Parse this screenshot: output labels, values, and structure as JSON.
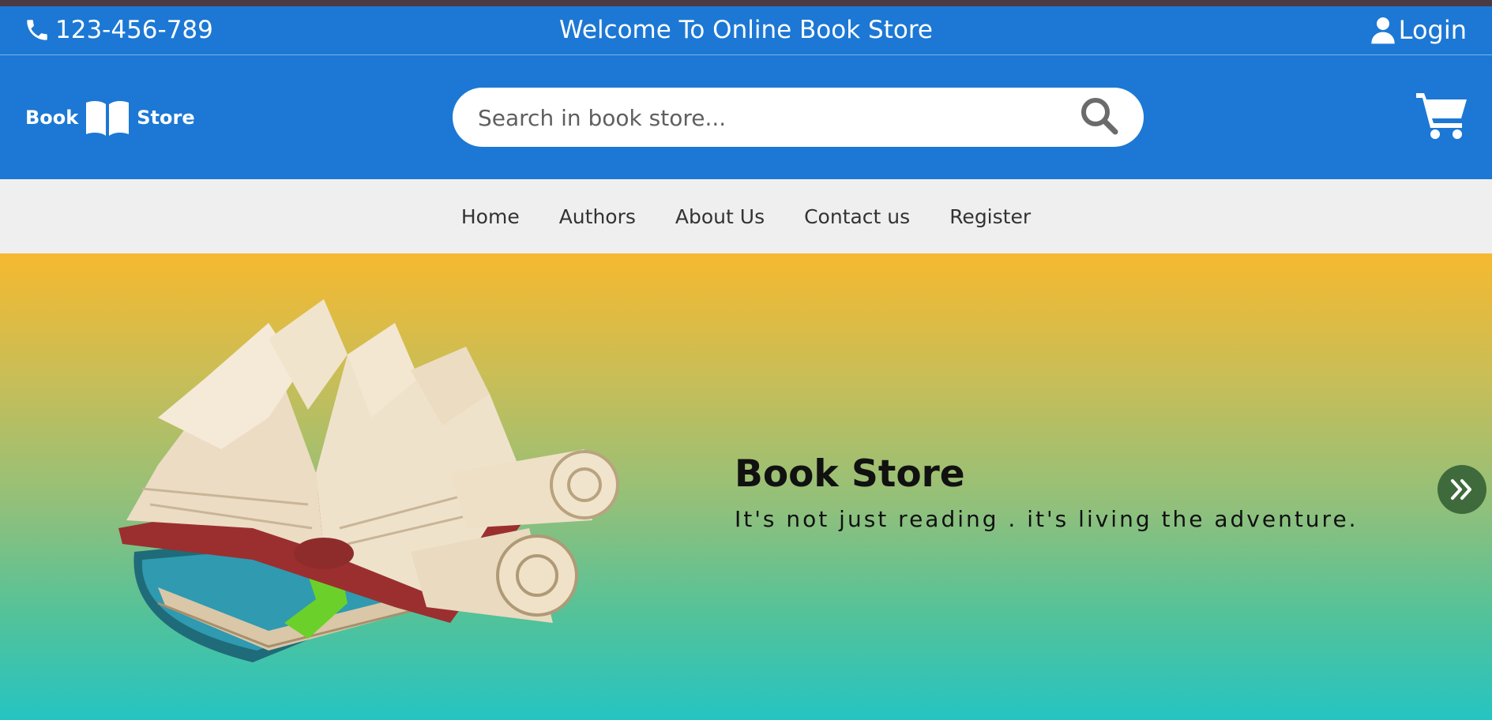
{
  "top_bar": {
    "phone": "123-456-789",
    "welcome": "Welcome To Online Book Store",
    "login_label": "Login"
  },
  "header": {
    "logo_left": "Book",
    "logo_right": "Store",
    "search_placeholder": "Search in book store..."
  },
  "nav": {
    "items": [
      {
        "label": "Home"
      },
      {
        "label": "Authors"
      },
      {
        "label": "About Us"
      },
      {
        "label": "Contact us"
      },
      {
        "label": "Register"
      }
    ]
  },
  "hero": {
    "title": "Book Store",
    "subtitle": "It's not just reading . it's living the adventure."
  },
  "colors": {
    "primary_blue": "#1c78d4",
    "nav_bg": "#efefef",
    "hero_gradient_top": "#f6b92f",
    "hero_gradient_bottom": "#25c4c2",
    "next_button": "#3f6b3c"
  },
  "icons": [
    "phone-icon",
    "user-icon",
    "book-icon",
    "search-icon",
    "cart-icon",
    "chevrons-right-icon"
  ]
}
